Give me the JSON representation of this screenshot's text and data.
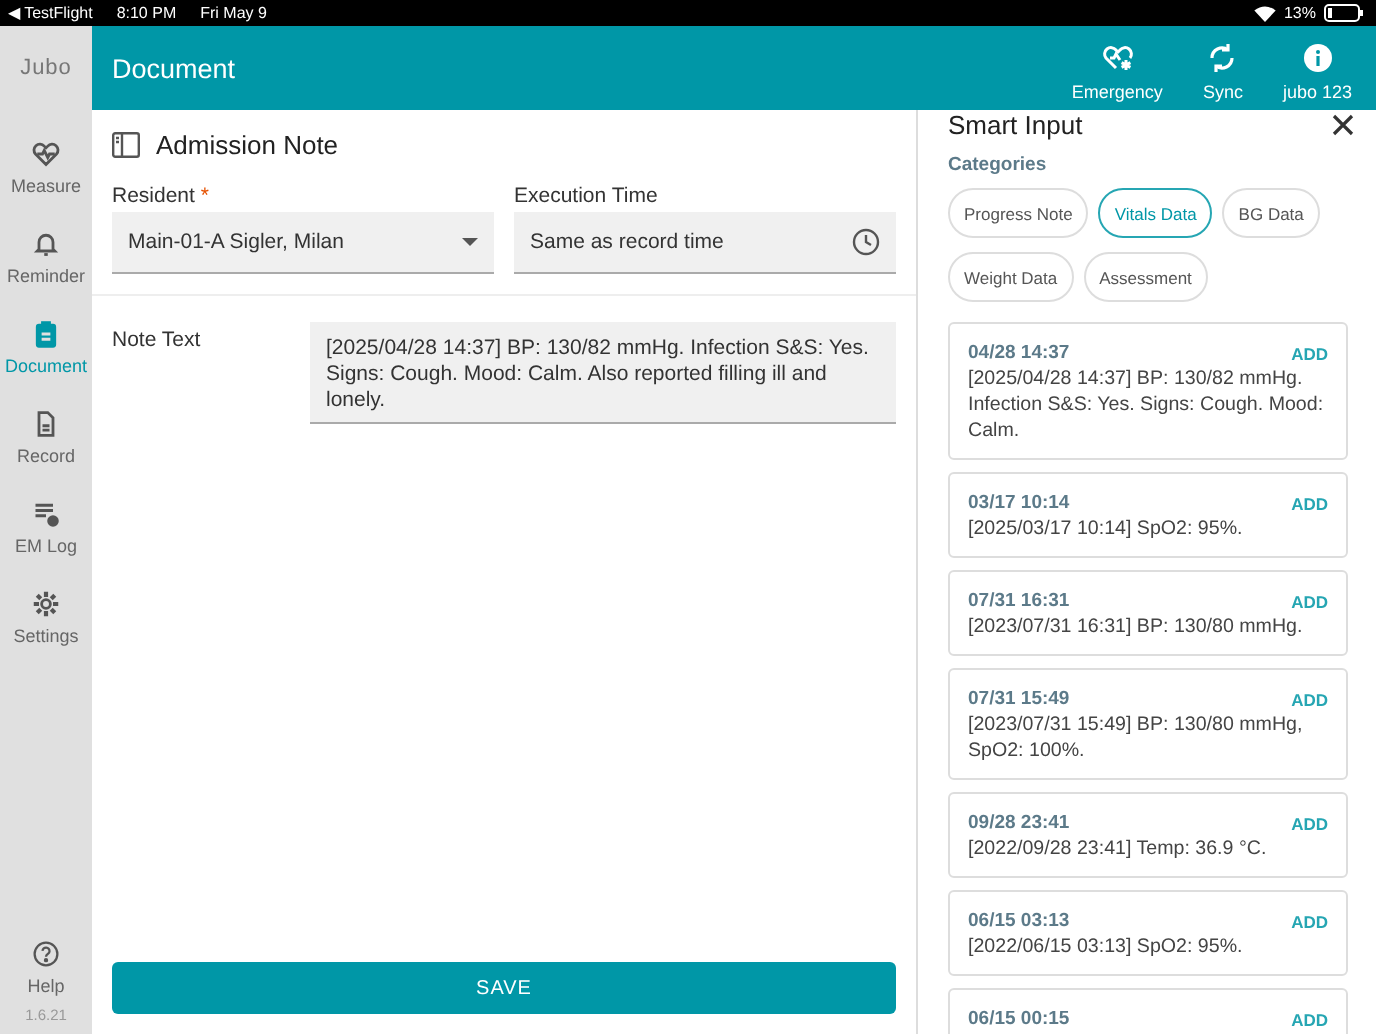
{
  "status_bar": {
    "back": "◀ TestFlight",
    "time": "8:10 PM",
    "date": "Fri May 9",
    "battery": "13%"
  },
  "header": {
    "logo": "Jubo",
    "title": "Document",
    "actions": [
      {
        "label": "Emergency"
      },
      {
        "label": "Sync"
      },
      {
        "label": "jubo 123"
      }
    ]
  },
  "sidebar": {
    "items": [
      {
        "label": "Measure",
        "selected": false
      },
      {
        "label": "Reminder",
        "selected": false
      },
      {
        "label": "Document",
        "selected": true
      },
      {
        "label": "Record",
        "selected": false
      },
      {
        "label": "EM Log",
        "selected": false
      },
      {
        "label": "Settings",
        "selected": false
      }
    ],
    "help": "Help",
    "version": "1.6.21"
  },
  "form": {
    "title": "Admission Note",
    "resident": {
      "label": "Resident",
      "required_mark": "*",
      "value": "Main-01-A Sigler, Milan"
    },
    "execution_time": {
      "label": "Execution Time",
      "value": "Same as record time"
    },
    "note": {
      "label": "Note Text",
      "value": "[2025/04/28 14:37] BP: 130/82 mmHg. Infection S&S: Yes. Signs: Cough. Mood: Calm. Also reported filling ill and lonely."
    },
    "save": "SAVE"
  },
  "smart_input": {
    "title": "Smart Input",
    "categories_label": "Categories",
    "categories": [
      {
        "label": "Progress Note",
        "selected": false
      },
      {
        "label": "Vitals Data",
        "selected": true
      },
      {
        "label": "BG Data",
        "selected": false
      },
      {
        "label": "Weight Data",
        "selected": false
      },
      {
        "label": "Assessment",
        "selected": false
      }
    ],
    "entries": [
      {
        "time": "04/28 14:37",
        "text": "[2025/04/28 14:37] BP: 130/82 mmHg. Infection S&S: Yes. Signs: Cough. Mood: Calm.",
        "action": "ADD"
      },
      {
        "time": "03/17 10:14",
        "text": "[2025/03/17 10:14] SpO2: 95%.",
        "action": "ADD"
      },
      {
        "time": "07/31 16:31",
        "text": "[2023/07/31 16:31] BP: 130/80 mmHg.",
        "action": "ADD"
      },
      {
        "time": "07/31 15:49",
        "text": "[2023/07/31 15:49] BP: 130/80 mmHg, SpO2: 100%.",
        "action": "ADD"
      },
      {
        "time": "09/28 23:41",
        "text": "[2022/09/28 23:41] Temp: 36.9 °C.",
        "action": "ADD"
      },
      {
        "time": "06/15 03:13",
        "text": "[2022/06/15 03:13] SpO2: 95%.",
        "action": "ADD"
      },
      {
        "time": "06/15 00:15",
        "action": "ADD"
      }
    ]
  }
}
